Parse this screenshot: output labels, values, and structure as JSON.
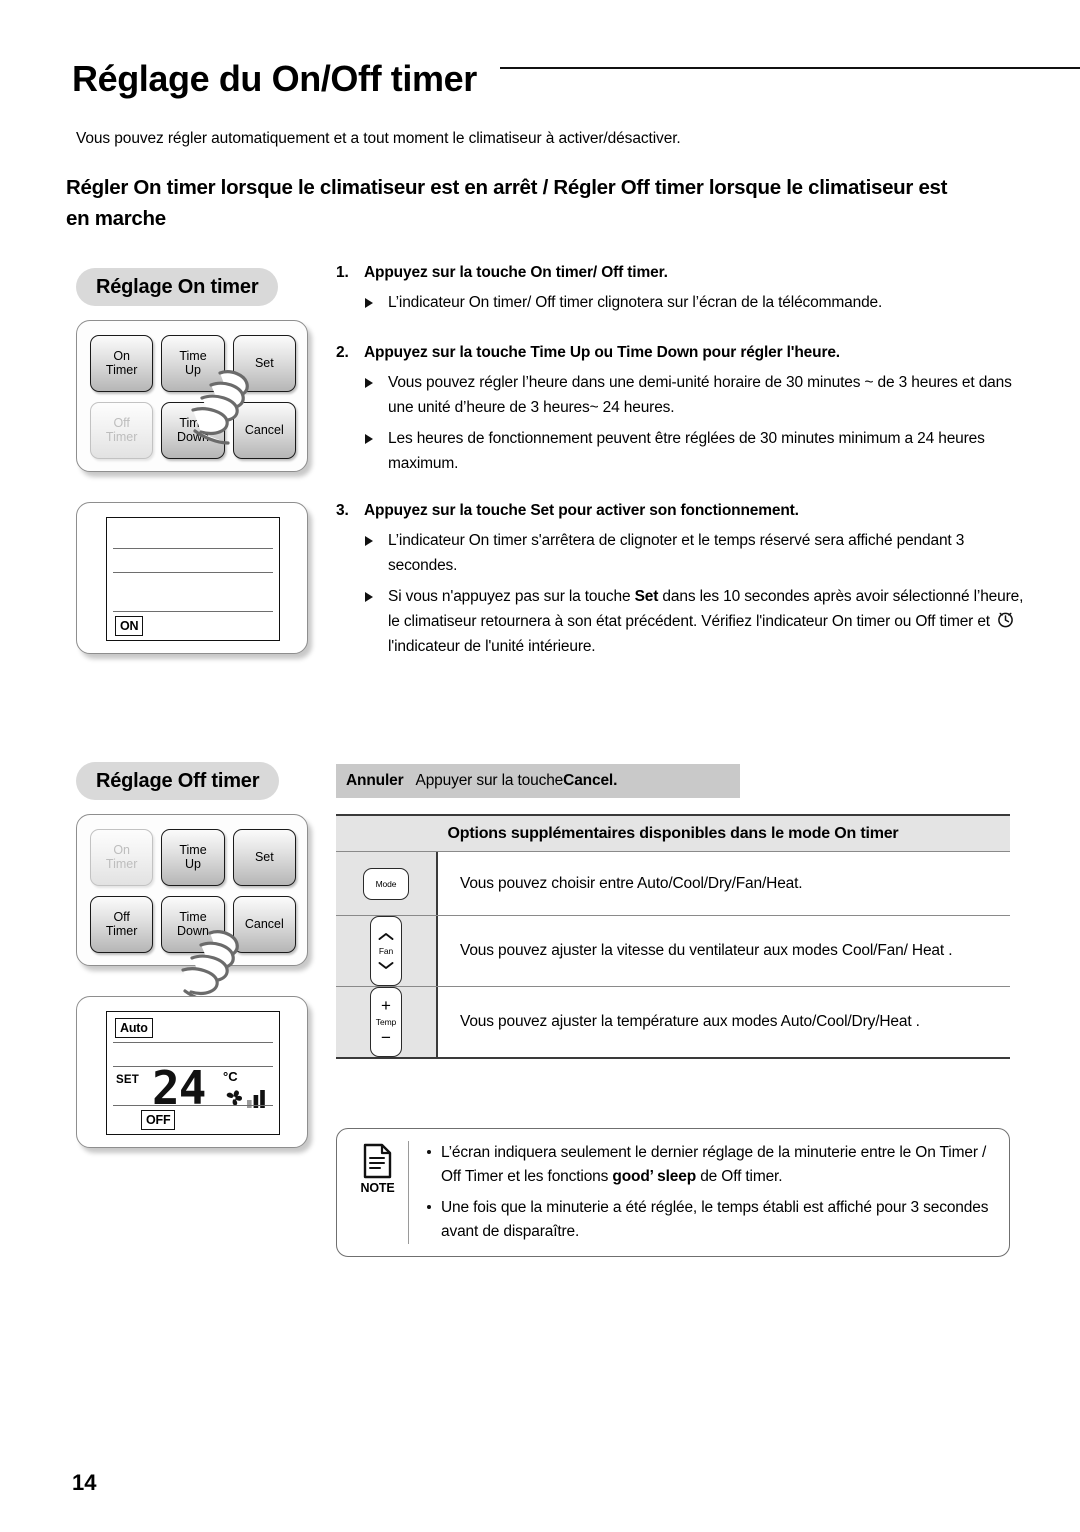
{
  "page": {
    "title": "Réglage du On/Off timer",
    "intro": "Vous pouvez régler automatiquement et a tout moment le climatiseur à activer/désactiver.",
    "subtitle": "Régler On timer  lorsque le climatiseur est en arrêt / Régler Off timer lorsque le climatiseur est en marche",
    "number": "14"
  },
  "sections": {
    "on_timer": {
      "pill_label": "Réglage On timer",
      "buttons": [
        {
          "line1": "On",
          "line2": "Timer",
          "state": "active"
        },
        {
          "line1": "Time",
          "line2": "Up",
          "state": "active"
        },
        {
          "line1": "Set",
          "line2": "",
          "state": "active"
        },
        {
          "line1": "Off",
          "line2": "Timer",
          "state": "dim"
        },
        {
          "line1": "Time",
          "line2": "Down",
          "state": "active"
        },
        {
          "line1": "Cancel",
          "line2": "",
          "state": "active"
        }
      ],
      "lcd": {
        "badge_bottom": "ON"
      }
    },
    "off_timer": {
      "pill_label": "Réglage Off timer",
      "buttons": [
        {
          "line1": "On",
          "line2": "Timer",
          "state": "dim"
        },
        {
          "line1": "Time",
          "line2": "Up",
          "state": "active"
        },
        {
          "line1": "Set",
          "line2": "",
          "state": "active"
        },
        {
          "line1": "Off",
          "line2": "Timer",
          "state": "active"
        },
        {
          "line1": "Time",
          "line2": "Down",
          "state": "active"
        },
        {
          "line1": "Cancel",
          "line2": "",
          "state": "active"
        }
      ],
      "lcd": {
        "badge_top": "Auto",
        "set_label": "SET",
        "temperature": "24",
        "unit": "°C",
        "badge_bottom": "OFF"
      }
    }
  },
  "steps": [
    {
      "number": "1.",
      "heading": "Appuyez sur la touche On timer/ Off timer.",
      "bullets": [
        "L’indicateur On timer/ Off timer clignotera sur l’écran de la télécommande."
      ]
    },
    {
      "number": "2.",
      "heading": "Appuyez sur la touche Time Up ou Time Down pour régler l'heure.",
      "bullets": [
        "Vous pouvez régler l’heure dans une demi-unité horaire de 30 minutes ~ de 3 heures et dans une unité d’heure de 3 heures~ 24 heures.",
        "Les heures de fonctionnement peuvent être réglées de 30 minutes minimum a 24 heures maximum."
      ]
    },
    {
      "number": "3.",
      "heading": "Appuyez sur la touche Set pour activer son fonctionnement.",
      "bullets": [
        "L’indicateur On timer s'arrêtera de clignoter et le temps réservé sera affiché pendant 3 secondes."
      ],
      "bullet_set_before": "Si vous n'appuyez pas sur la touche ",
      "bullet_set_bold": "Set",
      "bullet_set_after": " dans les 10 secondes après avoir sélectionné l’heure, le climatiseur retournera à son état précédent. Vérifiez l'indicateur On timer ou Off timer et ",
      "bullet_set_tail": " l'indicateur de l'unité intérieure."
    }
  ],
  "cancel_bar": {
    "label_bold": "Annuler",
    "text": "Appuyer sur la touche ",
    "button_bold": "Cancel."
  },
  "options_table": {
    "header": "Options supplémentaires disponibles dans le mode On timer",
    "rows": [
      {
        "icon_label": "Mode",
        "icon_type": "mode-button",
        "description": "Vous pouvez choisir entre Auto/Cool/Dry/Fan/Heat."
      },
      {
        "icon_label": "Fan",
        "icon_type": "fan-button",
        "description": "Vous pouvez ajuster la vitesse du ventilateur aux modes Cool/Fan/ Heat ."
      },
      {
        "icon_label": "Temp",
        "icon_type": "temp-button",
        "description": "Vous pouvez ajuster la température aux modes Auto/Cool/Dry/Heat ."
      }
    ]
  },
  "note": {
    "label": "NOTE",
    "items": [
      {
        "before": "L’écran indiquera seulement le dernier réglage de la minuterie entre le On Timer / Off Timer et les fonctions ",
        "bold": "good’ sleep",
        "after": " de Off timer."
      },
      {
        "before": "Une fois que la minuterie a été réglée, le temps établi est affiché pour 3 secondes avant de disparaître.",
        "bold": "",
        "after": ""
      }
    ]
  }
}
